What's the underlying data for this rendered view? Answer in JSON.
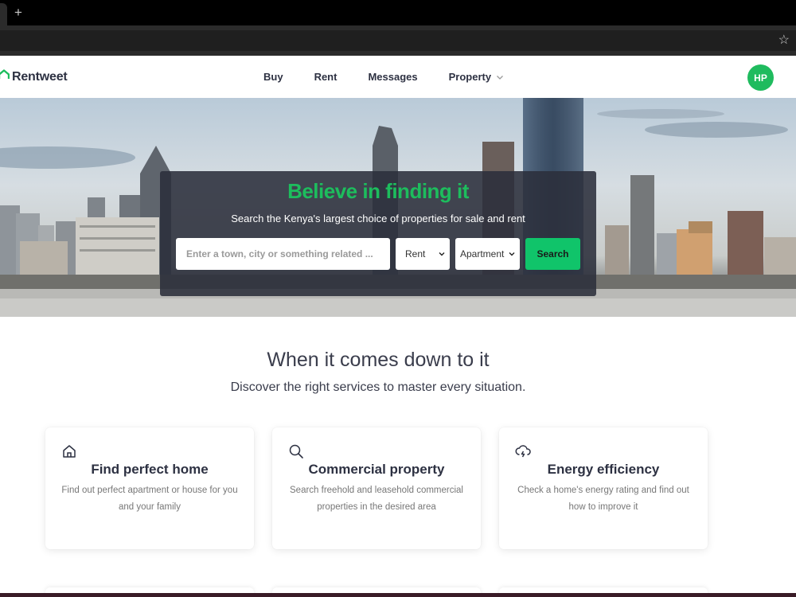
{
  "browser": {
    "new_tab_glyph": "+",
    "bookmark_glyph": "☆"
  },
  "nav": {
    "brand": "Rentweet",
    "links": [
      "Buy",
      "Rent",
      "Messages",
      "Property"
    ],
    "avatar_initials": "HP"
  },
  "hero": {
    "title": "Believe in finding it",
    "subtitle": "Search the Kenya's largest choice of properties for sale and rent",
    "search_placeholder": "Enter a town, city or something related ...",
    "listing_type": "Rent",
    "property_type": "Apartment",
    "search_button": "Search"
  },
  "section": {
    "title": "When it comes down to it",
    "subtitle": "Discover the right services to master every situation."
  },
  "cards": [
    {
      "icon": "home-icon",
      "title": "Find perfect home",
      "description": "Find out perfect apartment or house for you and your family"
    },
    {
      "icon": "search-icon",
      "title": "Commercial property",
      "description": "Search freehold and leasehold commercial properties in the desired area"
    },
    {
      "icon": "cloud-lightning-icon",
      "title": "Energy efficiency",
      "description": "Check a home's energy rating and find out how to improve it"
    }
  ],
  "colors": {
    "accent": "#1dbd5d",
    "button": "#10c46a",
    "text": "#2d3142",
    "hero_box": "#2b2f3b"
  }
}
